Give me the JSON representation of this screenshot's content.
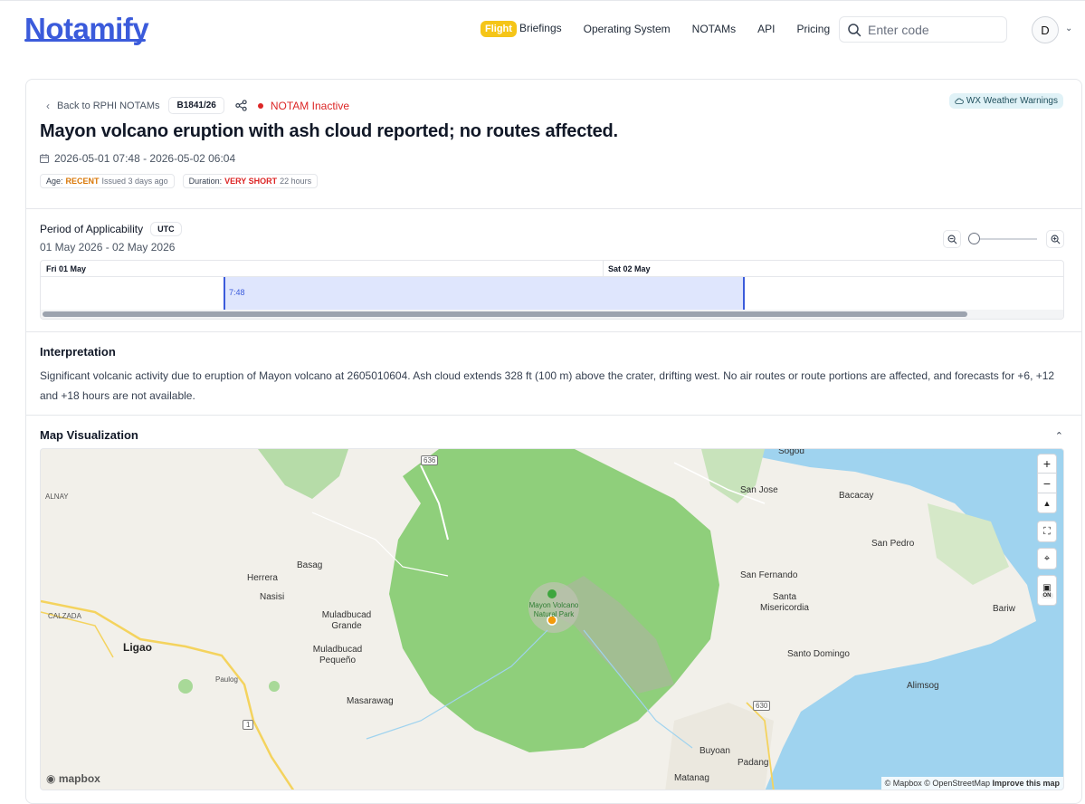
{
  "header": {
    "logo": "Notamify",
    "nav": {
      "flight_badge": "Flight",
      "briefings": "Briefings",
      "operating_system": "Operating System",
      "notams": "NOTAMs",
      "api": "API",
      "pricing": "Pricing"
    },
    "search_placeholder": "Enter code",
    "avatar_initial": "D"
  },
  "notam": {
    "back_label": "Back to RPHI NOTAMs",
    "code": "B1841/26",
    "status": "NOTAM Inactive",
    "wx_label": "WX Weather Warnings",
    "title": "Mayon volcano eruption with ash cloud reported; no routes affected.",
    "dates": "2026-05-01 07:48 - 2026-05-02 06:04",
    "age_label": "Age:",
    "age_value": "RECENT",
    "age_detail": "Issued 3 days ago",
    "duration_label": "Duration:",
    "duration_value": "VERY SHORT",
    "duration_detail": "22 hours"
  },
  "period": {
    "title": "Period of Applicability",
    "tz": "UTC",
    "range": "01 May 2026 - 02 May 2026",
    "day1": "Fri 01 May",
    "day2": "Sat 02 May",
    "start_marker": "7:48"
  },
  "interpretation": {
    "title": "Interpretation",
    "text": "Significant volcanic activity due to eruption of Mayon volcano at 2605010604. Ash cloud extends 328 ft (100 m) above the crater, drifting west. No air routes or route portions are affected, and forecasts for +6, +12 and +18 hours are not available."
  },
  "map": {
    "title": "Map Visualization",
    "places": {
      "sogod": "Sogod",
      "san_jose": "San Jose",
      "bacacay": "Bacacay",
      "alnay": "ALNAY",
      "san_pedro": "San Pedro",
      "herrera": "Herrera",
      "basag": "Basag",
      "san_fernando": "San Fernando",
      "nasisi": "Nasisi",
      "santa_misericordia": "Santa Misericordia",
      "mayon_park": "Mayon Volcano Natural Park",
      "calzada": "CALZADA",
      "muladbucad_grande": "Muladbucad Grande",
      "bariw": "Bariw",
      "ligao": "Ligao",
      "muladbucad_pequeno": "Muladbucad Pequeño",
      "santo_domingo": "Santo Domingo",
      "paulog": "Paulog",
      "masarawag": "Masarawag",
      "alimsog": "Alimsog",
      "padang": "Padang",
      "buyoan": "Buyoan",
      "matanag": "Matanag",
      "route_636": "636",
      "route_630": "630",
      "route_1": "1"
    },
    "controls": {
      "zoom_in": "+",
      "zoom_out": "−",
      "compass": "▲",
      "layers_on": "ON"
    },
    "logo": "mapbox",
    "attribution_mapbox": "© Mapbox",
    "attribution_osm": "© OpenStreetMap",
    "improve": "Improve this map"
  }
}
